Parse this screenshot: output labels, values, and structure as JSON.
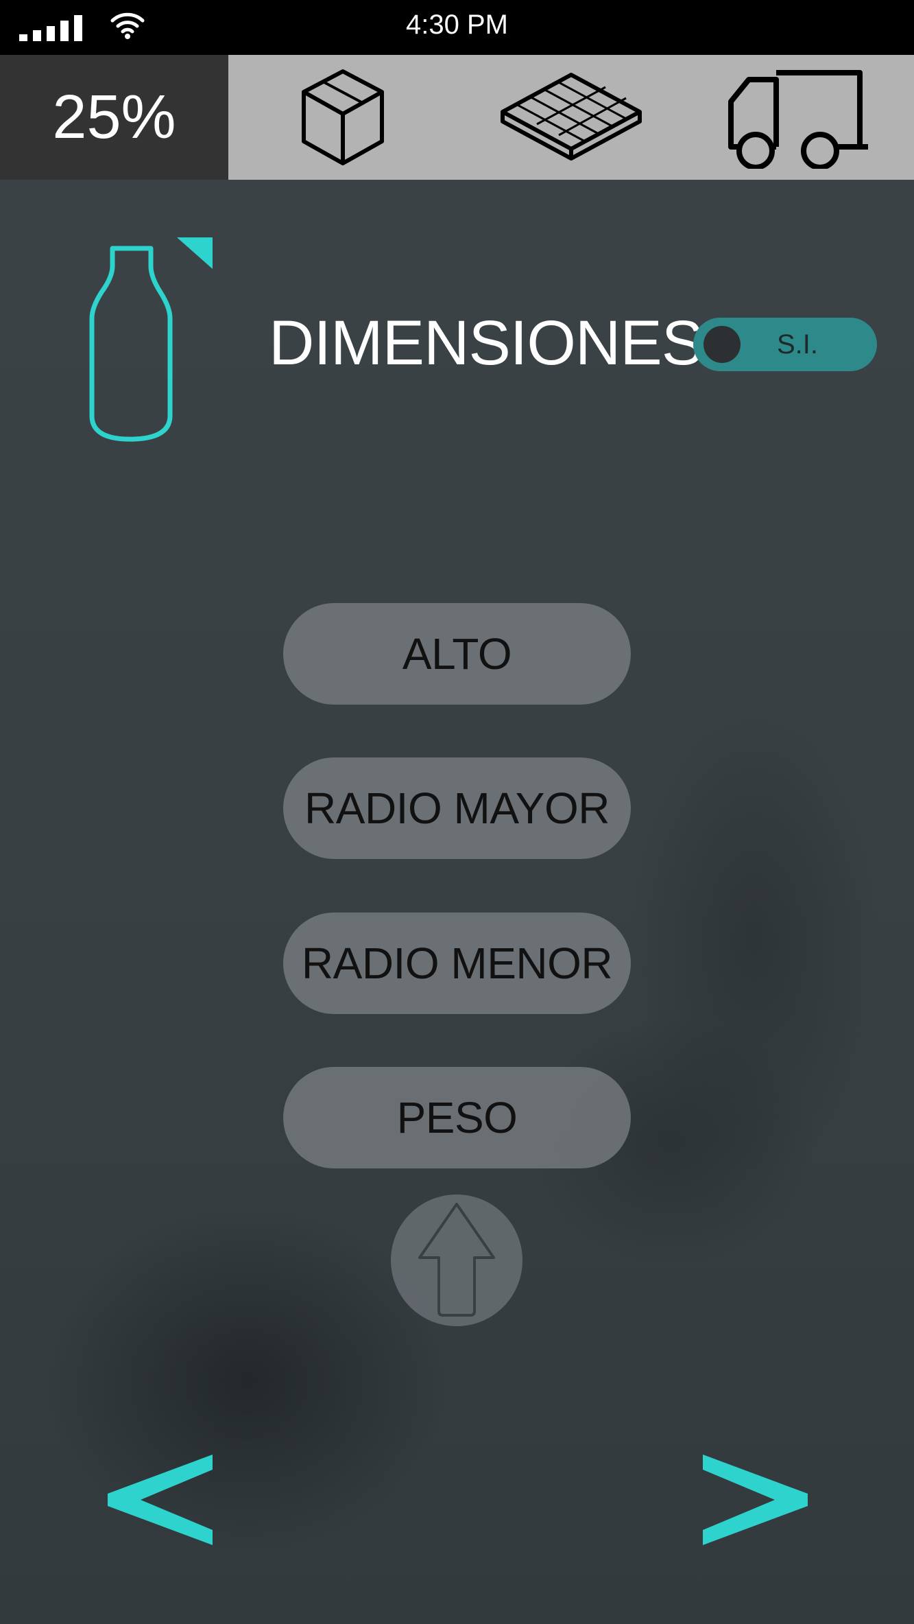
{
  "status_bar": {
    "time": "4:30 PM",
    "signal_icon": "signal-bars-icon",
    "wifi_icon": "wifi-icon"
  },
  "top_bar": {
    "progress_label": "25%",
    "progress_value": 0.25,
    "modes": [
      {
        "icon": "box-icon"
      },
      {
        "icon": "pallet-icon"
      },
      {
        "icon": "truck-icon"
      }
    ]
  },
  "header": {
    "product_icon": "bottle-icon",
    "title": "DIMENSIONES",
    "unit_toggle": {
      "label": "S.I.",
      "state": "on"
    }
  },
  "dimension_buttons": [
    {
      "label": "ALTO"
    },
    {
      "label": "RADIO MAYOR"
    },
    {
      "label": "RADIO MENOR"
    },
    {
      "label": "PESO"
    }
  ],
  "upload_button": {
    "icon": "up-arrow-icon"
  },
  "navigation": {
    "prev": {
      "icon": "chevron-left-icon"
    },
    "next": {
      "icon": "chevron-right-icon"
    }
  },
  "colors": {
    "accent": "#2ed3cd",
    "toggle_bg": "#2e8a8a",
    "status_bar_bg": "#000000",
    "percent_bg": "#333333",
    "mode_bar_bg": "#b3b3b3",
    "button_bg": "#787e82"
  }
}
